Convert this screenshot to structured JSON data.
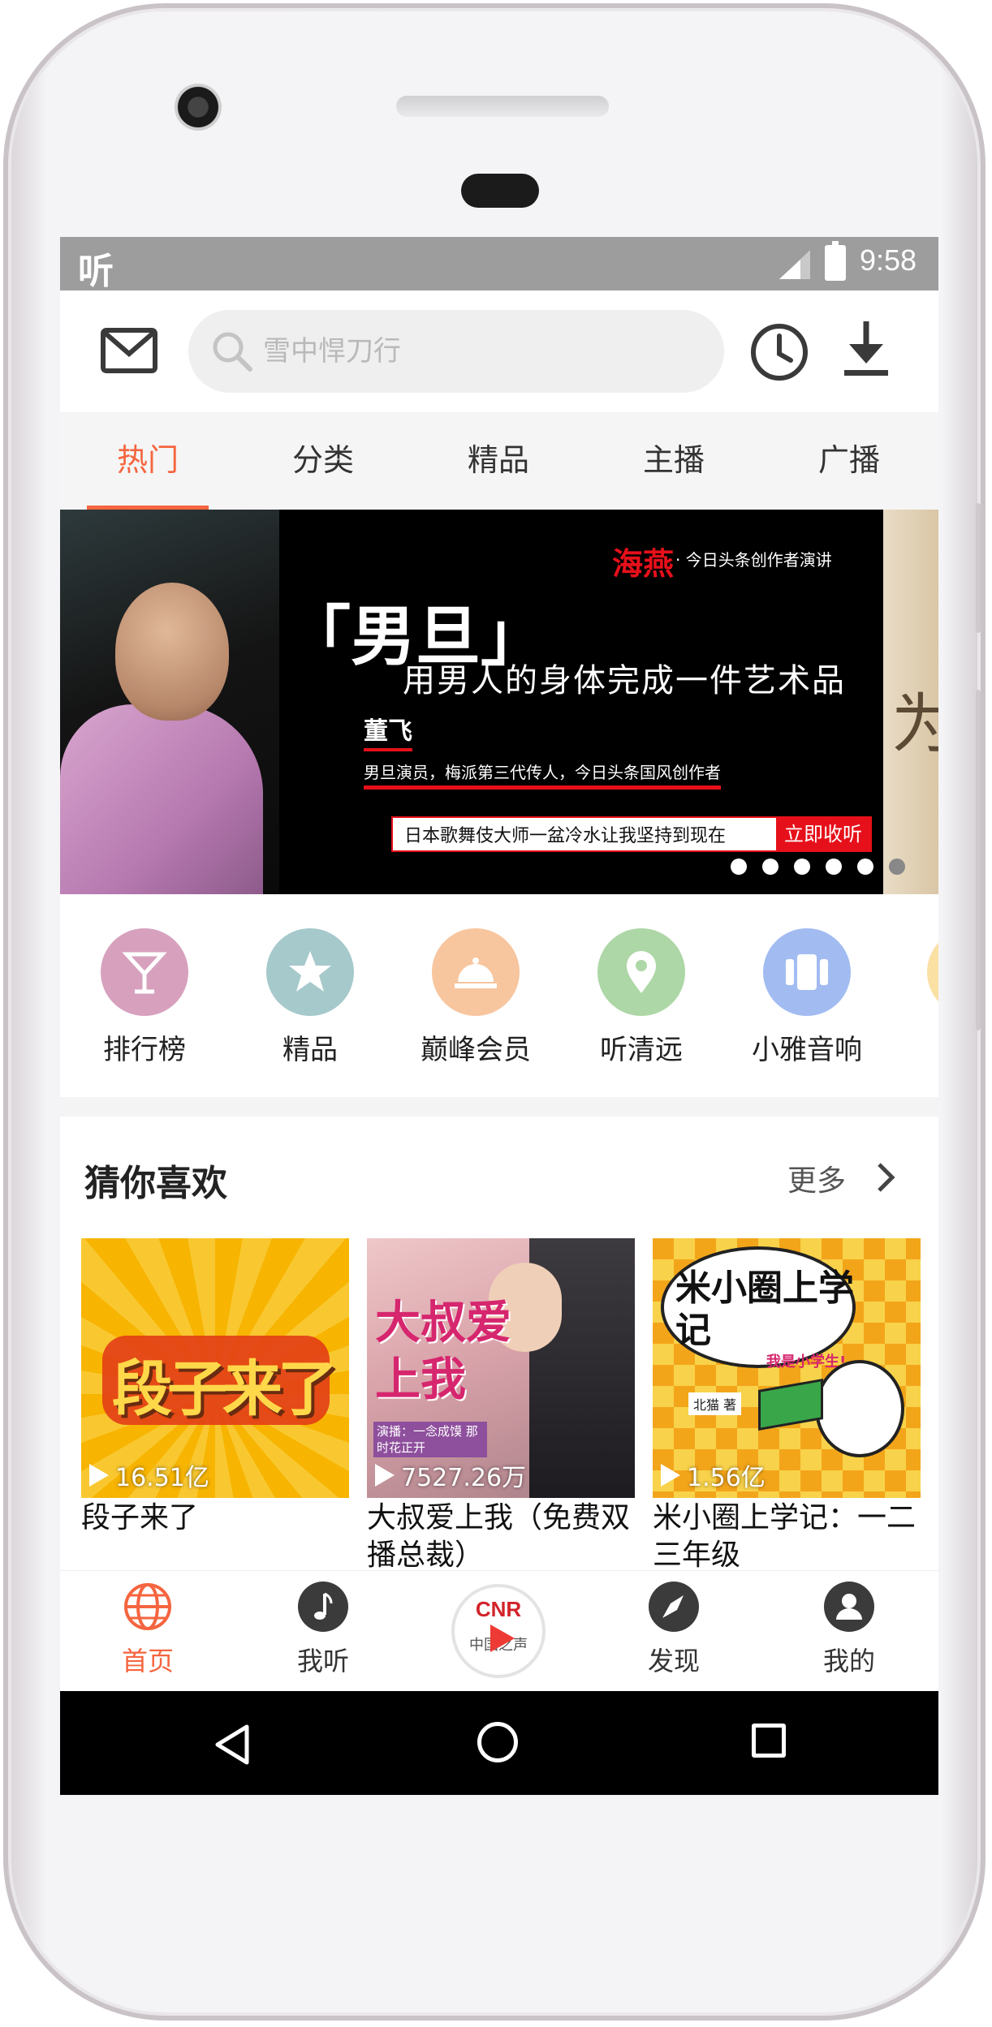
{
  "status_bar": {
    "app_glyph": "听",
    "time": "9:58"
  },
  "search": {
    "placeholder": "雪中悍刀行"
  },
  "tabs": [
    {
      "label": "热门",
      "active": true
    },
    {
      "label": "分类",
      "active": false
    },
    {
      "label": "精品",
      "active": false
    },
    {
      "label": "主播",
      "active": false
    },
    {
      "label": "广播",
      "active": false
    }
  ],
  "banner": {
    "brand": "海燕",
    "brand_sub": "· 今日头条创作者演讲",
    "headline": "「男旦」",
    "subtitle": "用男人的身体完成一件艺术品",
    "speaker": "董飞",
    "intro": "男旦演员，梅派第三代传人，今日头条国风创作者",
    "cta_text": "日本歌舞伎大师一盆冷水让我坚持到现在",
    "cta_button": "立即收听",
    "next_peek": "为",
    "slide_count": 6,
    "active_slide": 0
  },
  "quick_entries": [
    {
      "label": "排行榜",
      "icon": "cocktail-icon",
      "color": "#d7a1bd"
    },
    {
      "label": "精品",
      "icon": "star-icon",
      "color": "#a6c9cb"
    },
    {
      "label": "巅峰会员",
      "icon": "cloche-icon",
      "color": "#f7c59e"
    },
    {
      "label": "听清远",
      "icon": "location-pin-icon",
      "color": "#add7a6"
    },
    {
      "label": "小雅音响",
      "icon": "speaker-icon",
      "color": "#a2bcf2"
    }
  ],
  "recommend": {
    "title": "猜你喜欢",
    "more": "更多",
    "items": [
      {
        "title": "段子来了",
        "plays": "16.51亿",
        "cover_text": "段子来了"
      },
      {
        "title": "大叔爱上我（免费双播总裁）",
        "plays": "7527.26万",
        "cover_text": "大叔爱上我",
        "cover_badge": "演播：一念成馍 那时花正开"
      },
      {
        "title": "米小圈上学记：一二三年级",
        "plays": "1.56亿",
        "cover_text": "米小圈上学记",
        "cover_sub": "我是小学生!",
        "cover_author": "北猫 著"
      }
    ]
  },
  "bottom_nav": [
    {
      "label": "首页",
      "active": true
    },
    {
      "label": "我听",
      "active": false
    },
    {
      "label": "中国之声",
      "logo": "CNR"
    },
    {
      "label": "发现",
      "active": false
    },
    {
      "label": "我的",
      "active": false
    }
  ],
  "colors": {
    "accent": "#f5653f",
    "banner_red": "#e6101a"
  }
}
